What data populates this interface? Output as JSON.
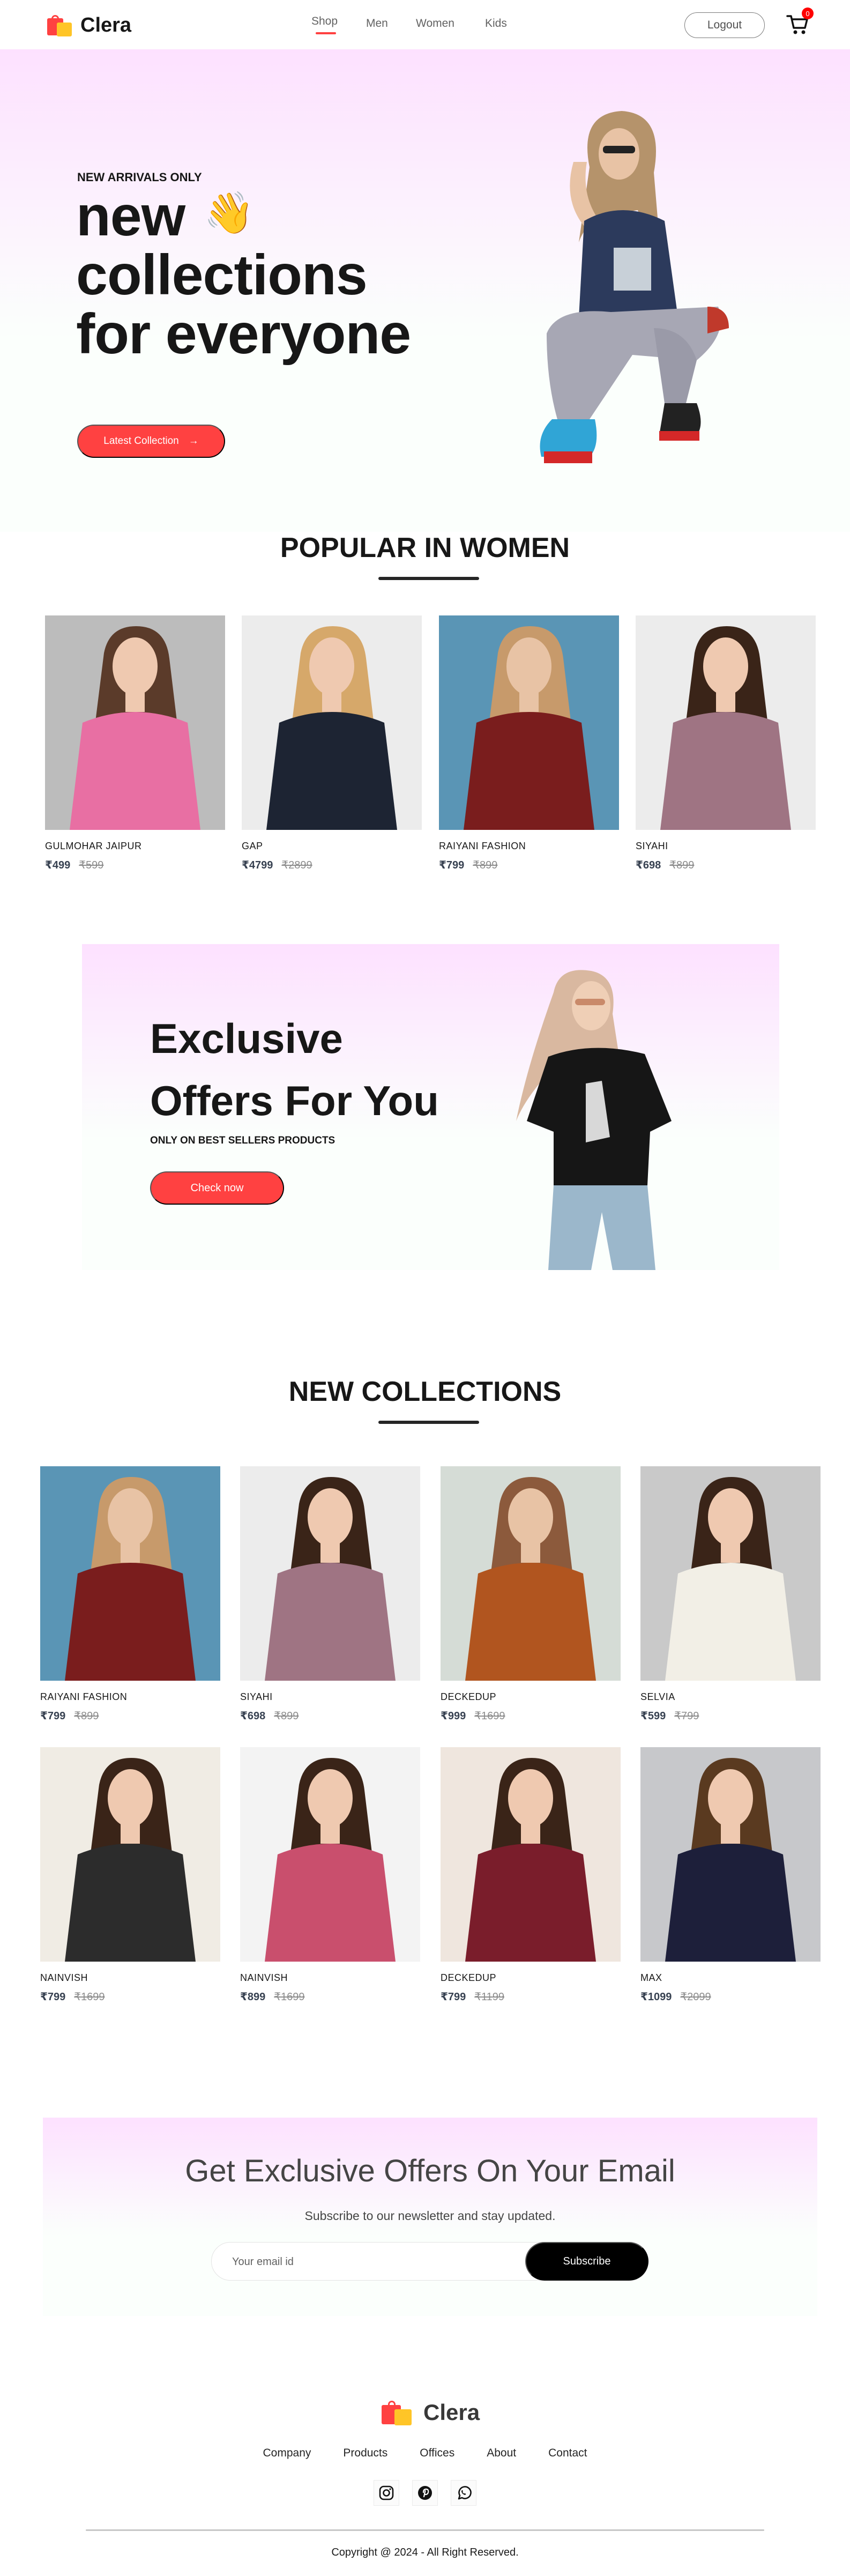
{
  "nav": {
    "brand": "Clera",
    "menu": [
      "Shop",
      "Men",
      "Women",
      "Kids"
    ],
    "active": "Shop",
    "logout_label": "Logout",
    "cart_count": "0"
  },
  "hero": {
    "eyebrow": "NEW ARRIVALS ONLY",
    "title_line1": "new",
    "title_line2": "collections",
    "title_line3": "for everyone",
    "wave": "👋",
    "cta_label": "Latest Collection",
    "cta_arrow": "→"
  },
  "popular": {
    "title": "POPULAR IN WOMEN",
    "items": [
      {
        "name": "GULMOHAR JAIPUR",
        "new_price": "₹499",
        "old_price": "₹599"
      },
      {
        "name": "GAP",
        "new_price": "₹4799",
        "old_price": "₹2899"
      },
      {
        "name": "RAIYANI FASHION",
        "new_price": "₹799",
        "old_price": "₹899"
      },
      {
        "name": "SIYAHI",
        "new_price": "₹698",
        "old_price": "₹899"
      }
    ]
  },
  "offers": {
    "title_line1": "Exclusive",
    "title_line2": "Offers For You",
    "subtitle": "ONLY ON BEST SELLERS PRODUCTS",
    "button_label": "Check now"
  },
  "new_collections": {
    "title": "NEW COLLECTIONS",
    "items": [
      {
        "name": "RAIYANI FASHION",
        "new_price": "₹799",
        "old_price": "₹899"
      },
      {
        "name": "SIYAHI",
        "new_price": "₹698",
        "old_price": "₹899"
      },
      {
        "name": "DECKEDUP",
        "new_price": "₹999",
        "old_price": "₹1699"
      },
      {
        "name": "SELVIA",
        "new_price": "₹599",
        "old_price": "₹799"
      },
      {
        "name": "NAINVISH",
        "new_price": "₹799",
        "old_price": "₹1699"
      },
      {
        "name": "NAINVISH",
        "new_price": "₹899",
        "old_price": "₹1699"
      },
      {
        "name": "DECKEDUP",
        "new_price": "₹799",
        "old_price": "₹1199"
      },
      {
        "name": "MAX",
        "new_price": "₹1099",
        "old_price": "₹2099"
      }
    ]
  },
  "newsletter": {
    "title": "Get Exclusive Offers On Your Email",
    "subtitle": "Subscribe to our newsletter and stay updated.",
    "placeholder": "Your email id",
    "button_label": "Subscribe"
  },
  "footer": {
    "brand": "Clera",
    "links": [
      "Company",
      "Products",
      "Offices",
      "About",
      "Contact"
    ],
    "social": [
      "instagram-icon",
      "pinterest-icon",
      "whatsapp-icon"
    ],
    "copyright": "Copyright @ 2024 - All Right Reserved."
  },
  "colors": {
    "accent": "#ff4141",
    "hero_gradient_top": "#fde1ff",
    "dark_button": "#000000"
  }
}
